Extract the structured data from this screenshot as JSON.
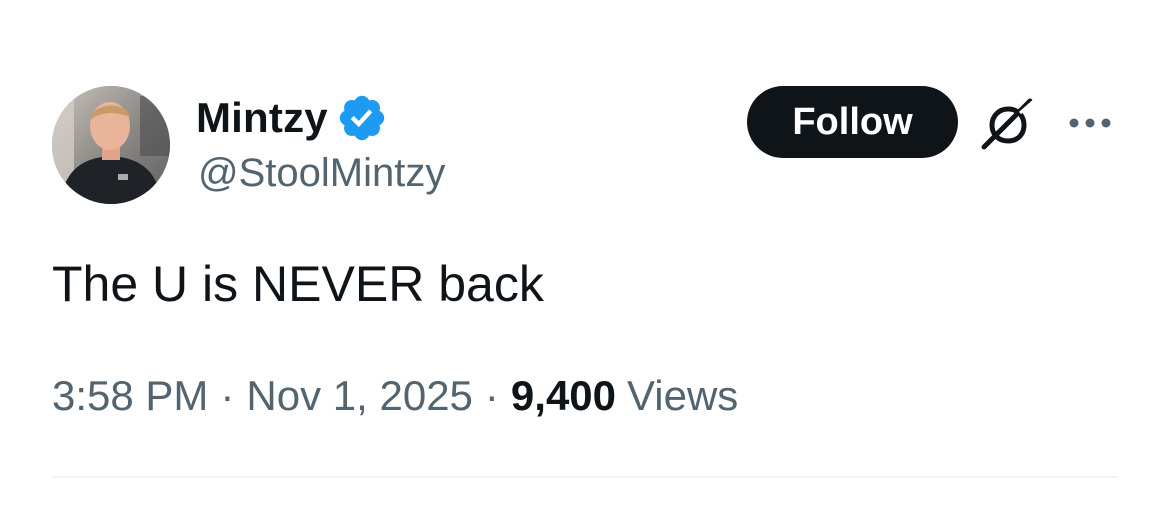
{
  "author": {
    "display_name": "Mintzy",
    "handle": "@StoolMintzy",
    "verified": true,
    "avatar_icon": "avatar-photo"
  },
  "actions": {
    "follow_label": "Follow",
    "grok_icon": "grok-icon",
    "more_icon": "more-options-icon"
  },
  "tweet": {
    "text": "The U is NEVER back"
  },
  "meta": {
    "time": "3:58 PM",
    "separator": "·",
    "date": "Nov 1, 2025",
    "views_count": "9,400",
    "views_label": "Views"
  },
  "colors": {
    "text_primary": "#0f1419",
    "text_secondary": "#536471",
    "verified_blue": "#1d9bf0",
    "divider": "#eff3f4",
    "follow_button_bg": "#0f1419"
  }
}
